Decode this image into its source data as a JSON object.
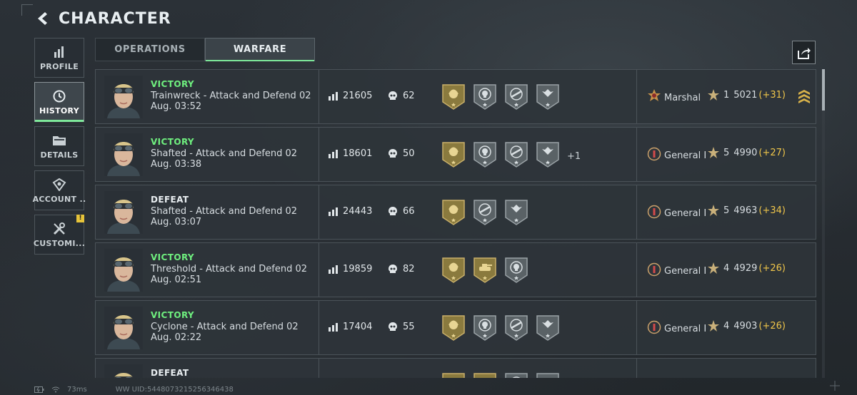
{
  "header": {
    "title": "CHARACTER"
  },
  "sidebar": {
    "items": [
      {
        "label": "PROFILE",
        "icon": "bar-chart-icon",
        "active": false
      },
      {
        "label": "HISTORY",
        "icon": "clock-icon",
        "active": true
      },
      {
        "label": "DETAILS",
        "icon": "folder-icon",
        "active": false
      },
      {
        "label": "ACCOUNT ..",
        "icon": "account-icon",
        "active": false
      },
      {
        "label": "CUSTOMI...",
        "icon": "tools-icon",
        "active": false,
        "badge": "!"
      }
    ]
  },
  "tabs": [
    {
      "label": "OPERATIONS",
      "active": false
    },
    {
      "label": "WARFARE",
      "active": true
    }
  ],
  "share": {
    "icon": "share-icon"
  },
  "matches": [
    {
      "result": "VICTORY",
      "map": "Trainwreck - Attack and Defend 02",
      "date": "Aug. 03:52",
      "score": "21605",
      "kills": "62",
      "medals": [
        "gold-lion",
        "silver-skull",
        "silver-rifle",
        "silver-eagle"
      ],
      "extra": "",
      "rank": "Marshal",
      "rank_icon": "marshal",
      "level": "1",
      "points": "5021",
      "delta": "(+31)",
      "chevrons": true
    },
    {
      "result": "VICTORY",
      "map": "Shafted - Attack and Defend 02",
      "date": "Aug. 03:38",
      "score": "18601",
      "kills": "50",
      "medals": [
        "gold-lion",
        "silver-skull",
        "silver-rifle",
        "silver-eagle"
      ],
      "extra": "+1",
      "rank": "General I",
      "rank_icon": "general",
      "level": "5",
      "points": "4990",
      "delta": "(+27)",
      "chevrons": false
    },
    {
      "result": "DEFEAT",
      "map": "Shafted - Attack and Defend 02",
      "date": "Aug. 03:07",
      "score": "24443",
      "kills": "66",
      "medals": [
        "gold-lion",
        "silver-rifle",
        "silver-eagle"
      ],
      "extra": "",
      "rank": "General I",
      "rank_icon": "general",
      "level": "5",
      "points": "4963",
      "delta": "(+34)",
      "chevrons": false
    },
    {
      "result": "VICTORY",
      "map": "Threshold - Attack and Defend 02",
      "date": "Aug. 02:51",
      "score": "19859",
      "kills": "82",
      "medals": [
        "gold-lion",
        "gold-tank",
        "silver-skull"
      ],
      "extra": "",
      "rank": "General I",
      "rank_icon": "general",
      "level": "4",
      "points": "4929",
      "delta": "(+26)",
      "chevrons": false
    },
    {
      "result": "VICTORY",
      "map": "Cyclone - Attack and Defend 02",
      "date": "Aug. 02:22",
      "score": "17404",
      "kills": "55",
      "medals": [
        "gold-lion",
        "silver-skull",
        "silver-rifle",
        "silver-eagle"
      ],
      "extra": "",
      "rank": "General I",
      "rank_icon": "general",
      "level": "4",
      "points": "4903",
      "delta": "(+26)",
      "chevrons": false
    },
    {
      "result": "DEFEAT",
      "map": "",
      "date": "",
      "score": "",
      "kills": "",
      "medals": [
        "gold-lion",
        "gold-tank",
        "silver-skull",
        "silver-eagle"
      ],
      "extra": "",
      "rank": "",
      "rank_icon": "general",
      "level": "",
      "points": "",
      "delta": "",
      "chevrons": false
    }
  ],
  "status_bar": {
    "ping": "73ms",
    "uid": "WW UID:5448073215256346438"
  },
  "colors": {
    "victory": "#6ff07f",
    "accent": "#7ee89a",
    "gold": "#f0c64a",
    "badge": "#e6c33a"
  }
}
